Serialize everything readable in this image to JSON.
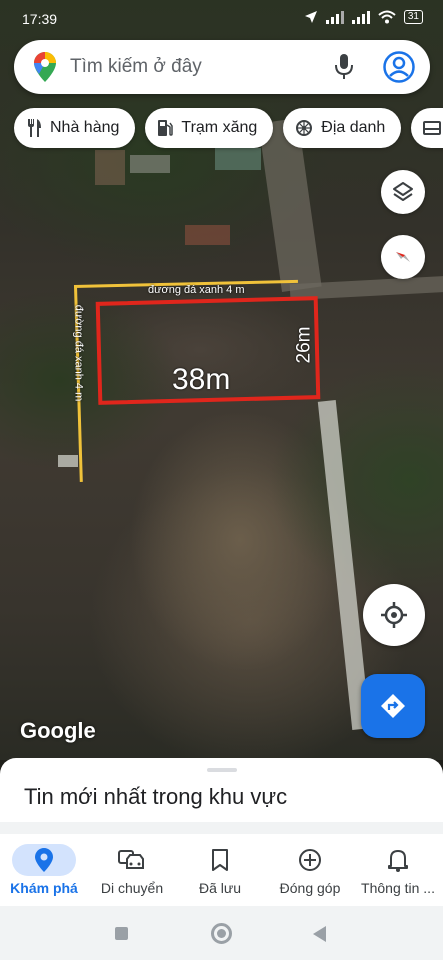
{
  "status_bar": {
    "time": "17:39",
    "battery": "31"
  },
  "search": {
    "placeholder": "Tìm kiếm ở đây"
  },
  "chips": [
    {
      "label": "Nhà hàng",
      "icon": "restaurant-icon"
    },
    {
      "label": "Trạm xăng",
      "icon": "gas-station-icon"
    },
    {
      "label": "Địa danh",
      "icon": "landmark-icon"
    },
    {
      "label": "",
      "icon": "hotel-icon"
    }
  ],
  "map": {
    "annotations": {
      "road_top": "đương đá xanh 4 m",
      "road_left": "đường đá xanh 4 m",
      "width": "38m",
      "depth": "26m"
    },
    "attribution": "Google",
    "colors": {
      "plot_outline": "#e0261c",
      "road_line": "#f0c23a"
    }
  },
  "sheet": {
    "title": "Tin mới nhất trong khu vực"
  },
  "nav": {
    "items": [
      {
        "label": "Khám phá",
        "icon": "explore-pin-icon",
        "active": true
      },
      {
        "label": "Di chuyển",
        "icon": "commute-car-icon",
        "active": false
      },
      {
        "label": "Đã lưu",
        "icon": "bookmark-icon",
        "active": false
      },
      {
        "label": "Đóng góp",
        "icon": "contribute-plus-icon",
        "active": false
      },
      {
        "label": "Thông tin ...",
        "icon": "notification-bell-icon",
        "active": false
      }
    ]
  },
  "accent_color": "#1a73e8"
}
